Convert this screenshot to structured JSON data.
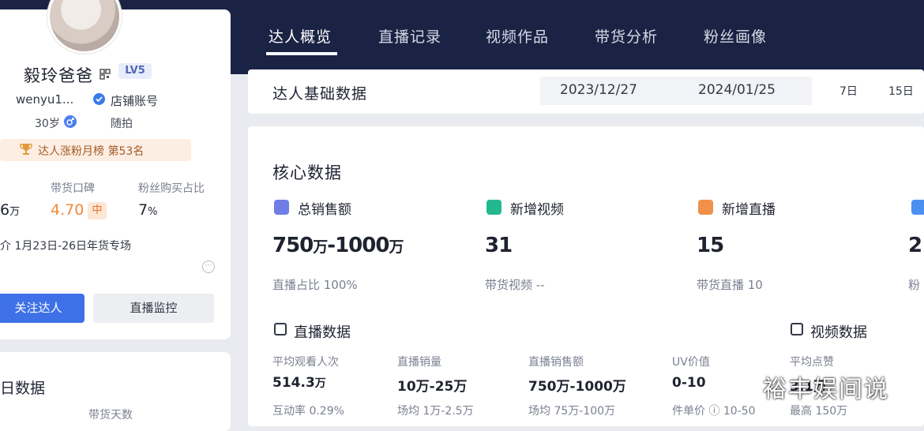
{
  "tabs": [
    {
      "label": "达人概览",
      "active": true
    },
    {
      "label": "直播记录"
    },
    {
      "label": "视频作品"
    },
    {
      "label": "带货分析"
    },
    {
      "label": "粉丝画像"
    }
  ],
  "profile": {
    "name": "毅玲爸爸",
    "level": "LV5",
    "uid": "wenyu1...",
    "account_type": "店铺账号",
    "age": "30岁",
    "category": "随拍",
    "rank": "达人涨粉月榜 第53名",
    "metrics": [
      {
        "label": "",
        "value": "6",
        "unit": "万"
      },
      {
        "label": "带货口碑",
        "value": "4.70",
        "badge": "中"
      },
      {
        "label": "粉丝购买占比",
        "value": "7",
        "unit": "%"
      }
    ],
    "promo": "介 1月23日-26日年货专场",
    "follow_label": "关注达人",
    "monitor_label": "直播监控",
    "section2_title": "日数据",
    "section2_sub": "带货天数"
  },
  "basic": {
    "title": "达人基础数据",
    "date_start": "2023/12/27",
    "date_end": "2024/01/25",
    "ranges": [
      "7日",
      "15日"
    ]
  },
  "core": {
    "title": "核心数据",
    "cards": [
      {
        "label": "总销售额",
        "value": "750",
        "unit1": "万",
        "value2": "-1000",
        "unit2": "万",
        "sub": "直播占比 100%"
      },
      {
        "label": "新增视频",
        "value": "31",
        "sub": "带货视频 --"
      },
      {
        "label": "新增直播",
        "value": "15",
        "sub": "带货直播 10"
      },
      {
        "label": "",
        "value": "2",
        "sub": "粉"
      }
    ]
  },
  "live": {
    "title": "直播数据",
    "stats": [
      {
        "label": "平均观看人次",
        "value": "514.3",
        "unit": "万",
        "sub": "互动率 0.29%"
      },
      {
        "label": "直播销量",
        "value": "10万-25万",
        "sub": "场均 1万-2.5万"
      },
      {
        "label": "直播销售额",
        "value": "750万-1000万",
        "sub": "场均 75万-100万"
      },
      {
        "label": "UV价值",
        "value": "0-10",
        "sub": "件单价 ⓘ 10-50"
      }
    ]
  },
  "video": {
    "title": "视频数据",
    "stats": [
      {
        "label": "平均点赞",
        "value": "3.1万",
        "sub": "最高 150万"
      }
    ]
  },
  "watermark": "裕丰娱间说",
  "colors": {
    "nav_bg": "#1b2344",
    "primary": "#3e71e7",
    "rating": "#f08a3a"
  }
}
